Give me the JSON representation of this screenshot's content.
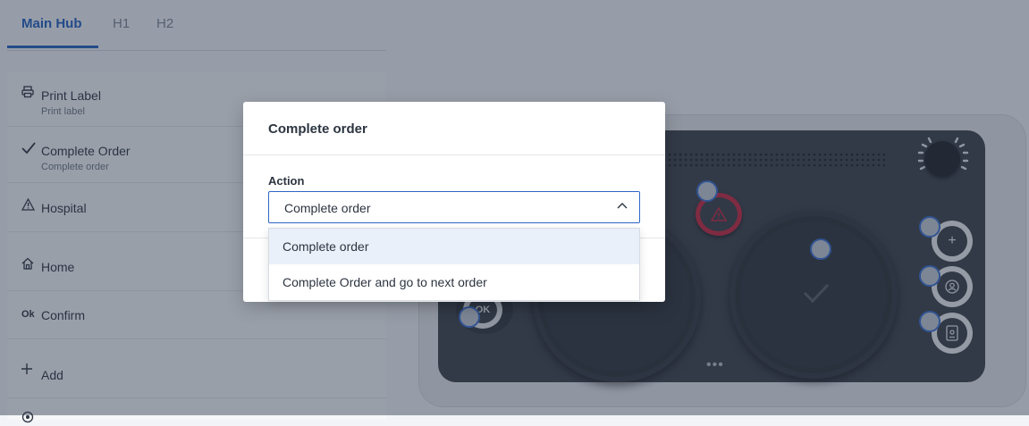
{
  "tabs": [
    {
      "label": "Main Hub",
      "active": true
    },
    {
      "label": "H1",
      "active": false
    },
    {
      "label": "H2",
      "active": false
    }
  ],
  "actions": [
    {
      "icon": "printer-icon",
      "label": "Print Label",
      "sub": "Print label"
    },
    {
      "icon": "checkmark-icon",
      "label": "Complete Order",
      "sub": "Complete order"
    },
    {
      "icon": "warning-icon",
      "label": "Hospital",
      "sub": ""
    },
    {
      "icon": "home-icon",
      "label": "Home",
      "sub": ""
    },
    {
      "icon": "ok-icon",
      "icon_text": "Ok",
      "label": "Confirm",
      "sub": ""
    },
    {
      "icon": "plus-icon",
      "label": "Add",
      "sub": ""
    }
  ],
  "device": {
    "ok_label": "OK",
    "dots": "•••"
  },
  "modal": {
    "title": "Complete order",
    "field_label": "Action",
    "selected_value": "Complete order",
    "options": [
      {
        "label": "Complete order",
        "selected": true
      },
      {
        "label": "Complete Order and go to next order",
        "selected": false
      }
    ]
  },
  "colors": {
    "accent": "#1f5fbf",
    "warning": "#c6263f",
    "overlay": "rgba(40,52,72,0.45)"
  }
}
